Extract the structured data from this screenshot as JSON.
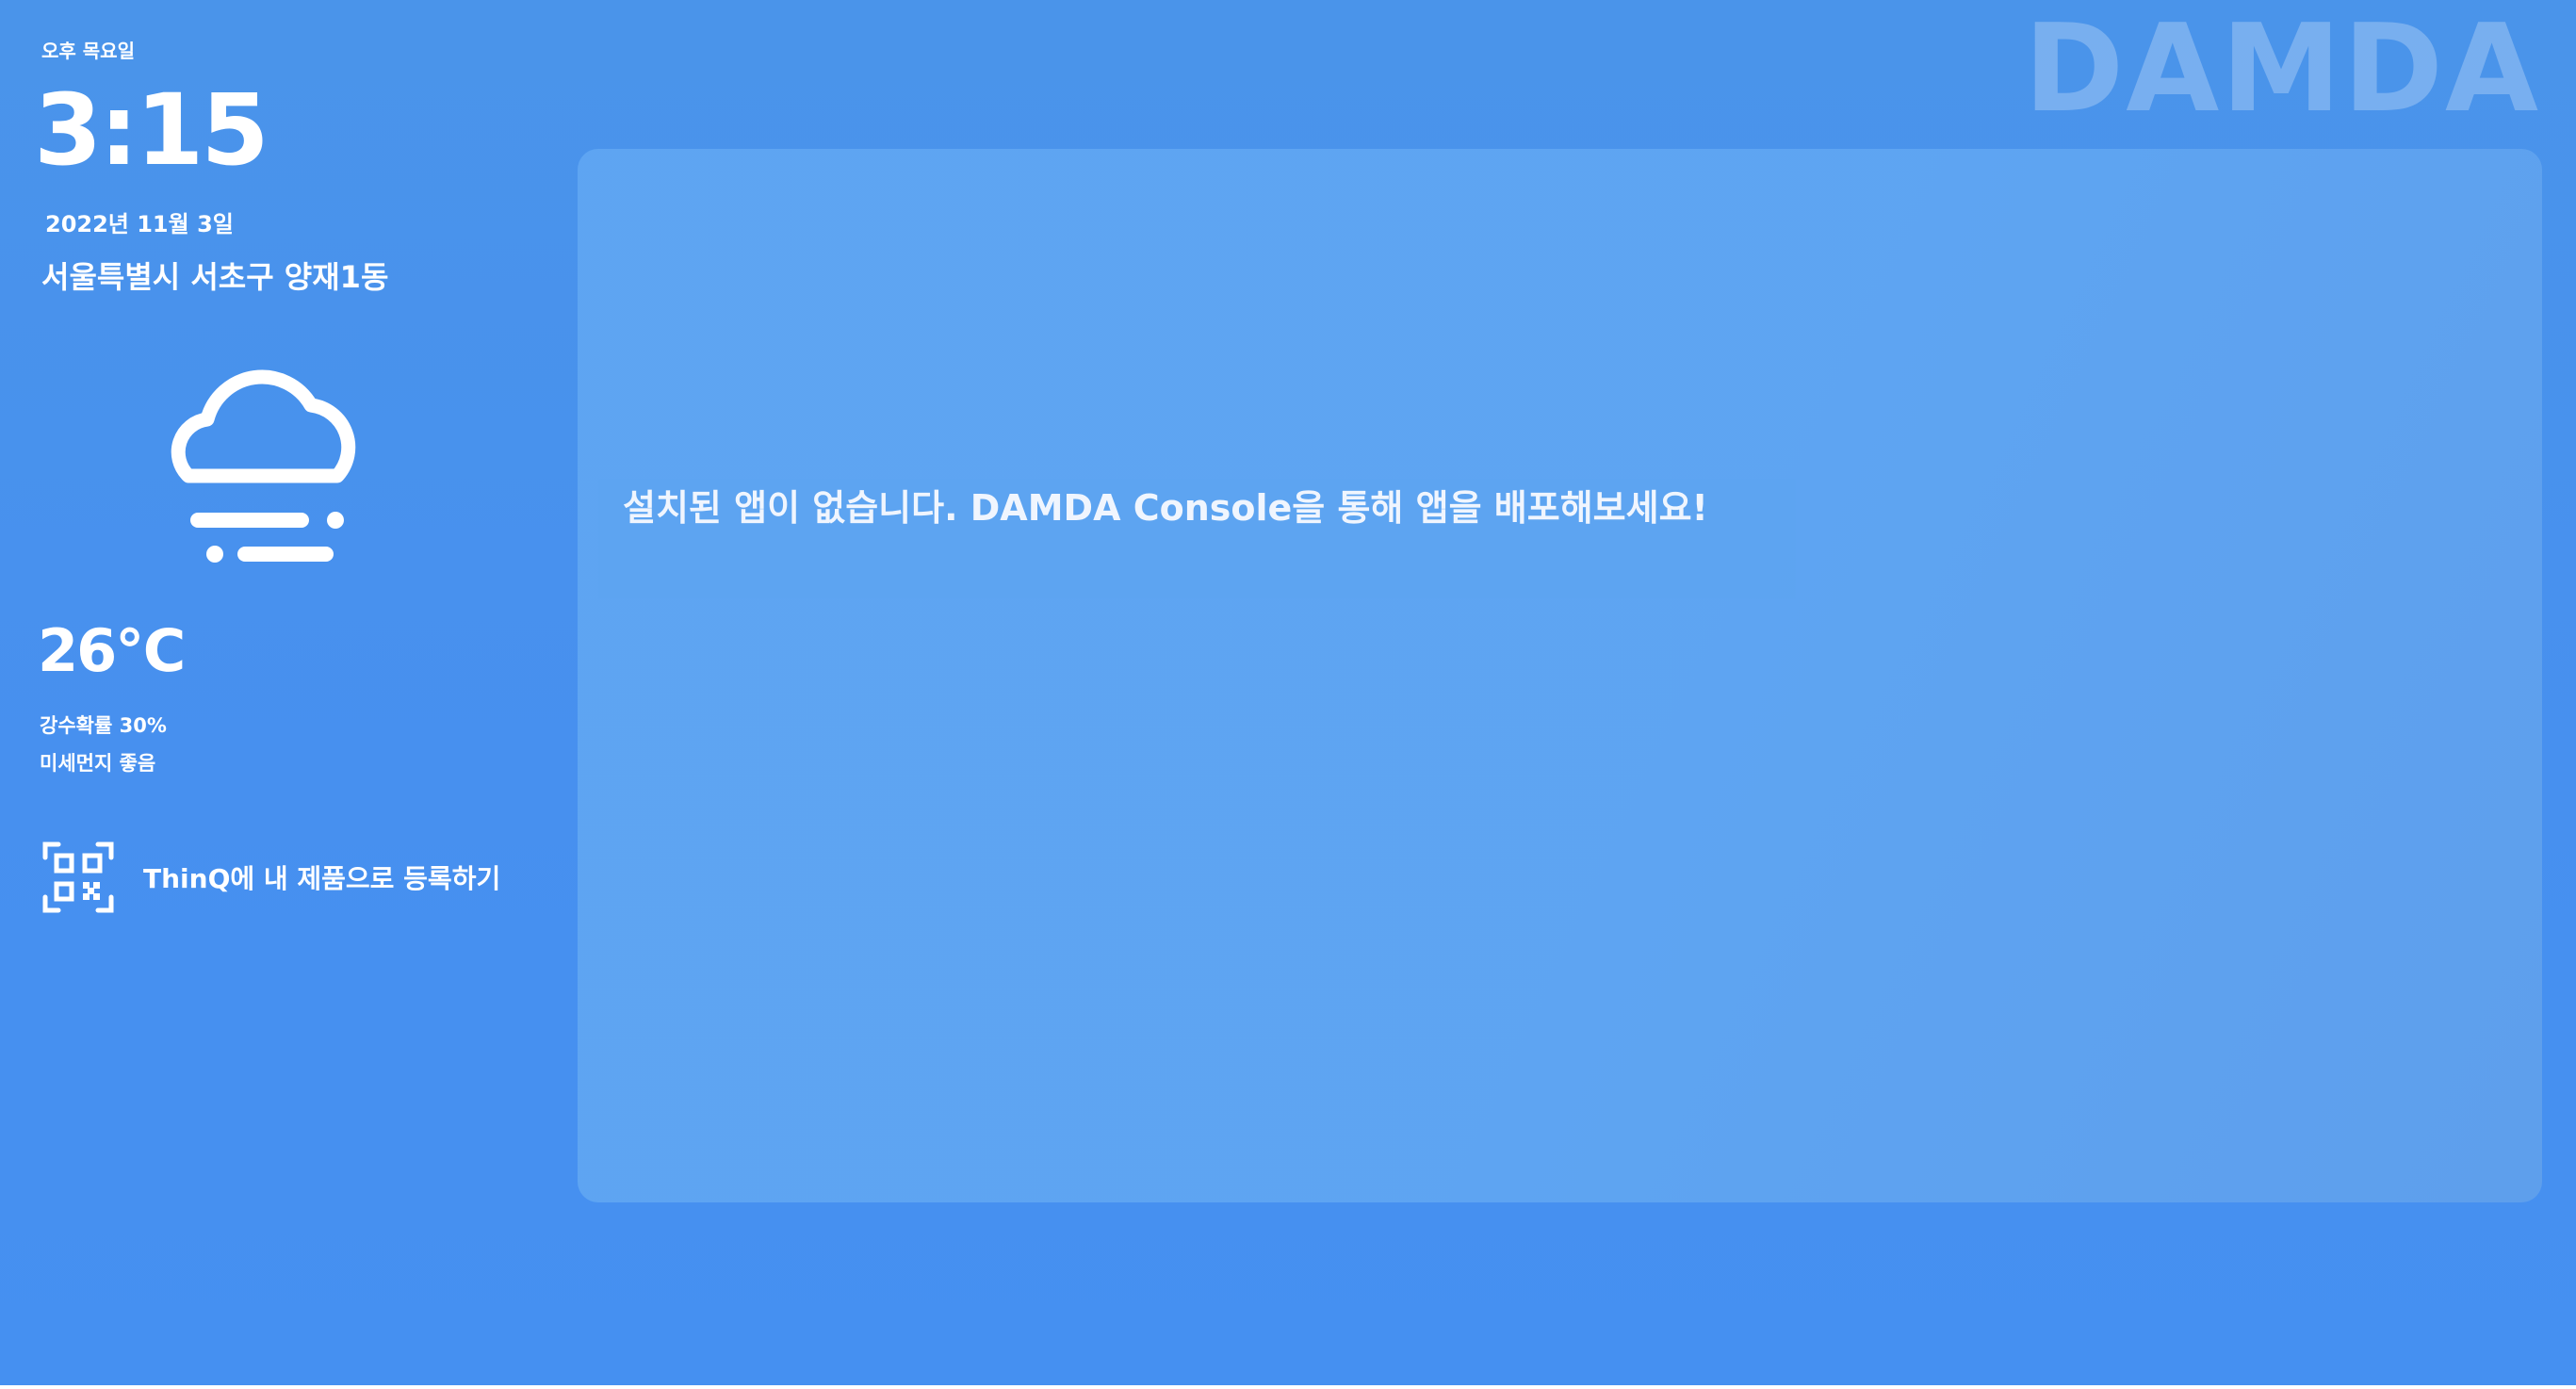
{
  "brand": {
    "logo_text": "DAMDA"
  },
  "sidebar": {
    "ampm_day": "오후 목요일",
    "time": "3:15",
    "date": "2022년 11월 3일",
    "location": "서울특별시 서초구 양재1동",
    "weather": {
      "icon": "cloud-fog-icon",
      "temperature": "26℃",
      "precipitation": "강수확률 30%",
      "fine_dust": "미세먼지 좋음"
    },
    "register": {
      "icon": "qr-code-icon",
      "label": "ThinQ에 내 제품으로 등록하기"
    }
  },
  "main": {
    "empty_message": "설치된 앱이 없습니다. DAMDA Console을 통해 앱을 배포해보세요!"
  },
  "colors": {
    "background": "#4790ef",
    "panel": "#5ea5f2",
    "text": "#ffffff"
  }
}
